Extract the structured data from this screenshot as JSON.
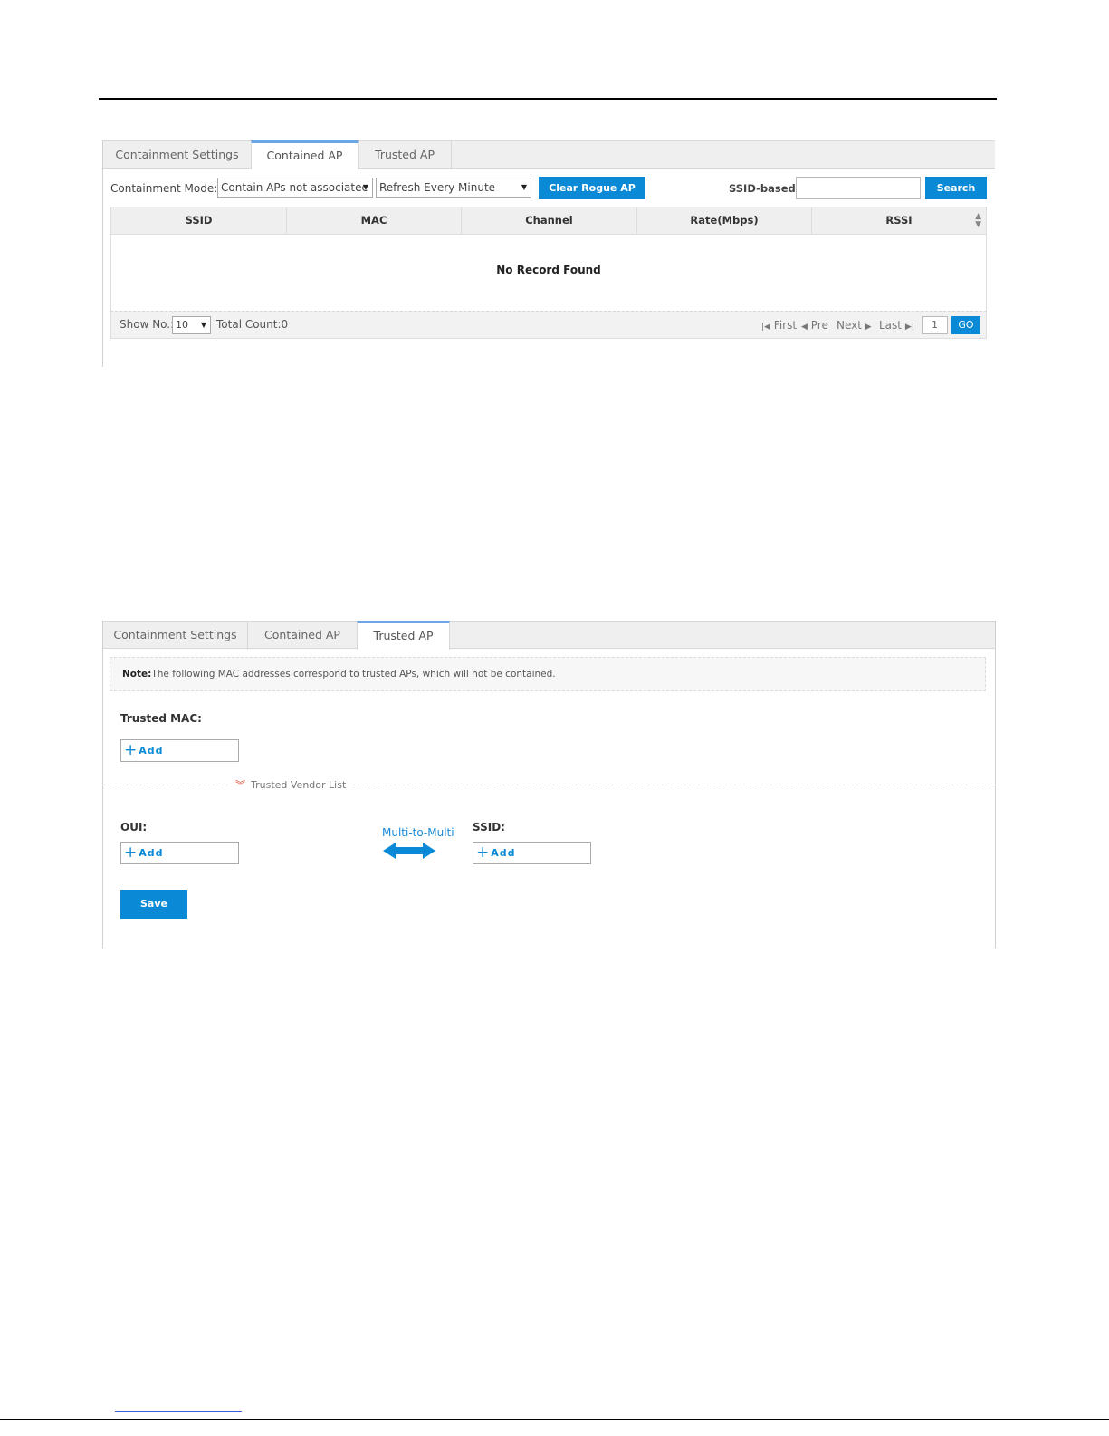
{
  "panel1": {
    "tabs": [
      "Containment Settings",
      "Contained AP",
      "Trusted AP"
    ],
    "containment_mode_label": "Containment Mode:",
    "containment_mode_value": "Contain APs not associatec",
    "refresh_value": "Refresh Every Minute",
    "clear_button": "Clear Rogue AP",
    "ssid_based_label": "SSID-based:",
    "search_button": "Search",
    "columns": [
      "SSID",
      "MAC",
      "Channel",
      "Rate(Mbps)",
      "RSSI"
    ],
    "empty_message": "No Record Found",
    "footer": {
      "show_no_label": "Show No.:",
      "show_no_value": "10",
      "total_count": "Total Count:0",
      "first": "First",
      "pre": "Pre",
      "next": "Next",
      "last": "Last",
      "page": "1",
      "go": "GO"
    }
  },
  "panel2": {
    "tabs": [
      "Containment Settings",
      "Contained AP",
      "Trusted AP"
    ],
    "note_bold": "Note:",
    "note_text": "The following MAC addresses correspond to trusted APs, which will not be contained.",
    "trusted_mac_label": "Trusted MAC:",
    "add_label": "Add",
    "vendor_list_label": "Trusted Vendor List",
    "oui_label": "OUI:",
    "multi_label": "Multi-to-Multi",
    "ssid_label": "SSID:",
    "save_button": "Save"
  },
  "colors": {
    "accent": "#0a8ad6",
    "active_tab_border": "#6aa7e6",
    "chevron": "#e2452b"
  }
}
